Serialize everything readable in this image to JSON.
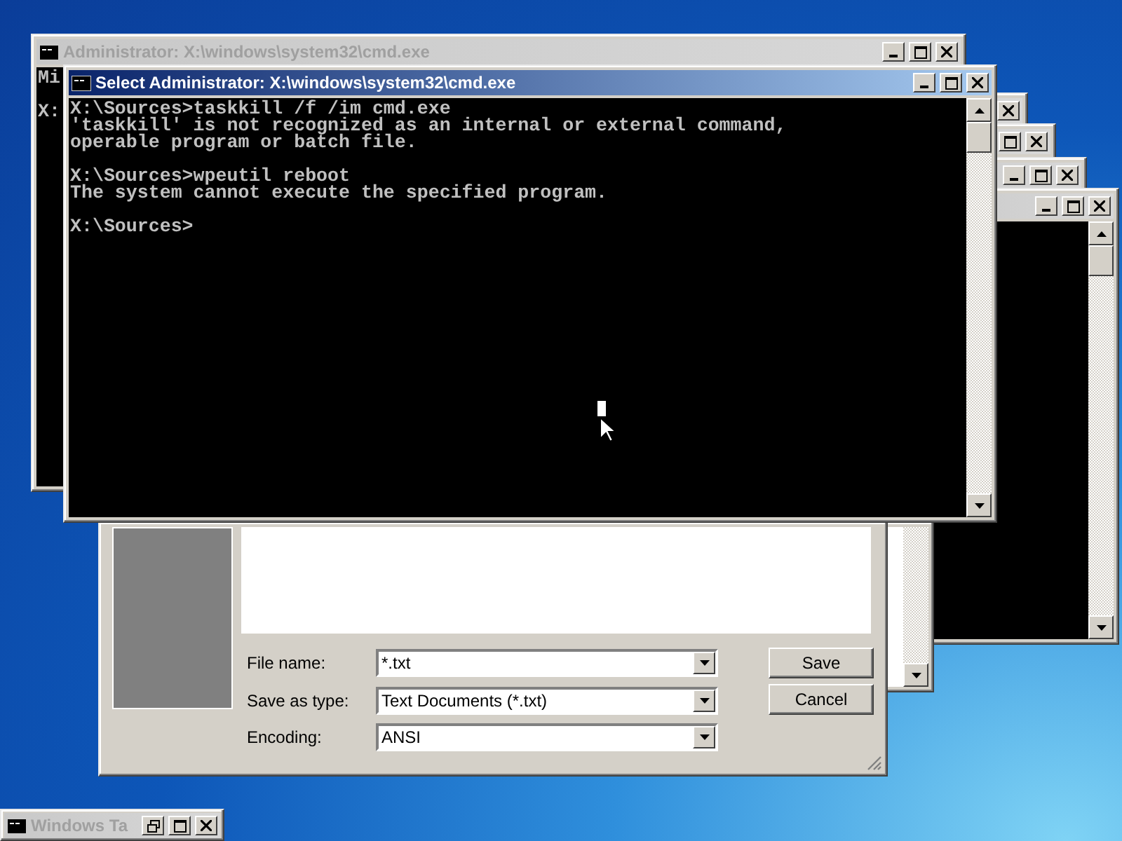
{
  "stacked_windows": [
    {
      "active": false
    },
    {
      "active": false
    },
    {
      "active": false
    },
    {
      "active": false
    }
  ],
  "save_dialog": {
    "fields": [
      {
        "label": "File name:",
        "value": "*.txt"
      },
      {
        "label": "Save as type:",
        "value": "Text Documents (*.txt)"
      },
      {
        "label": "Encoding:",
        "value": "ANSI"
      }
    ],
    "buttons": [
      "Save",
      "Cancel"
    ]
  },
  "console_back": {
    "title": "Administrator: X:\\windows\\system32\\cmd.exe",
    "active": false,
    "blocks": [
      [
        "Mi"
      ],
      [
        "X:"
      ]
    ]
  },
  "console_front": {
    "title": "Select Administrator: X:\\windows\\system32\\cmd.exe",
    "active": true,
    "blocks": [
      [
        "X:\\Sources>taskkill /f /im cmd.exe",
        "'taskkill' is not recognized as an internal or external command,",
        "operable program or batch file."
      ],
      [
        "X:\\Sources>wpeutil reboot",
        "The system cannot execute the specified program."
      ],
      [
        "X:\\Sources>"
      ]
    ]
  },
  "minimized_window": {
    "title": "Windows Ta",
    "active": false
  }
}
